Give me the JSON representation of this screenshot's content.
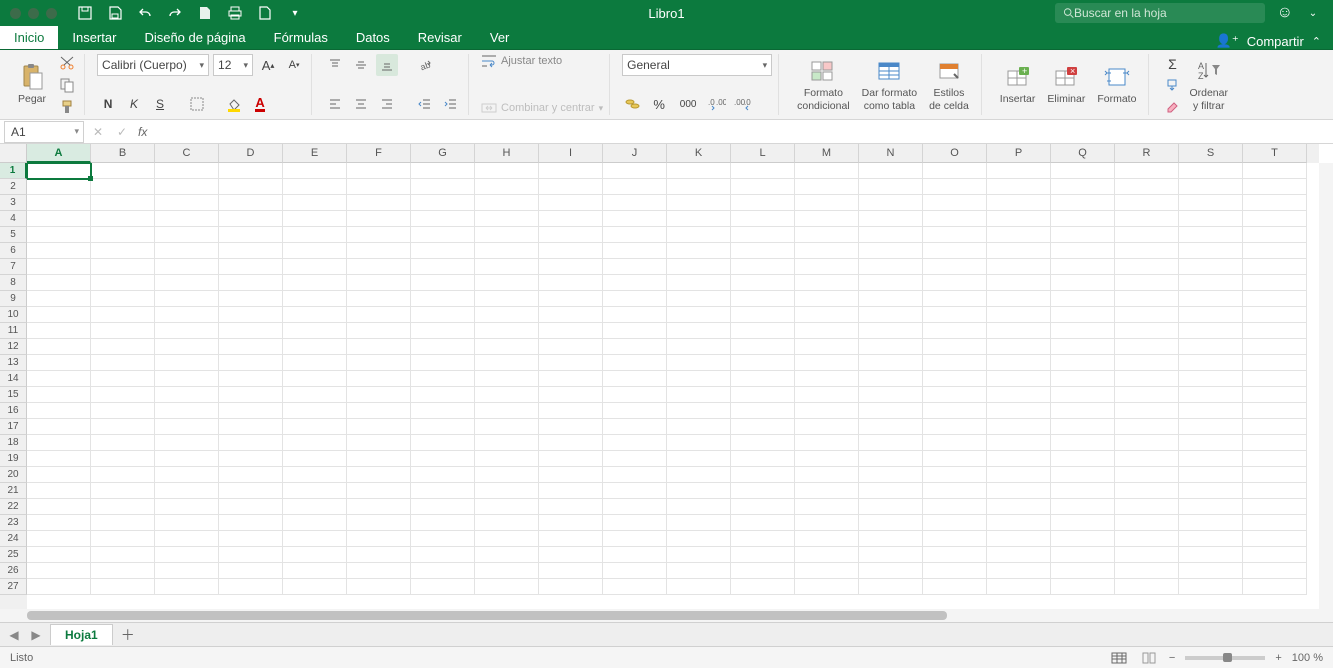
{
  "app": {
    "title": "Libro1",
    "search_placeholder": "Buscar en la hoja"
  },
  "tabs": [
    "Inicio",
    "Insertar",
    "Diseño de página",
    "Fórmulas",
    "Datos",
    "Revisar",
    "Ver"
  ],
  "active_tab": 0,
  "share_label": "Compartir",
  "ribbon": {
    "paste": "Pegar",
    "font_name": "Calibri (Cuerpo)",
    "font_size": "12",
    "bold": "N",
    "italic": "K",
    "underline": "S",
    "wrap_text": "Ajustar texto",
    "merge_center": "Combinar y centrar",
    "number_format": "General",
    "thousands": "000",
    "cond_format": "Formato\ncondicional",
    "format_table": "Dar formato\ncomo tabla",
    "cell_styles": "Estilos\nde celda",
    "insert": "Insertar",
    "delete": "Eliminar",
    "format": "Formato",
    "sort_filter": "Ordenar\ny filtrar"
  },
  "namebox": "A1",
  "columns": [
    "A",
    "B",
    "C",
    "D",
    "E",
    "F",
    "G",
    "H",
    "I",
    "J",
    "K",
    "L",
    "M",
    "N",
    "O",
    "P",
    "Q",
    "R",
    "S",
    "T"
  ],
  "row_count": 27,
  "selected": {
    "row": 1,
    "col": 0
  },
  "sheet_tab": "Hoja1",
  "status": "Listo",
  "zoom": "100 %"
}
